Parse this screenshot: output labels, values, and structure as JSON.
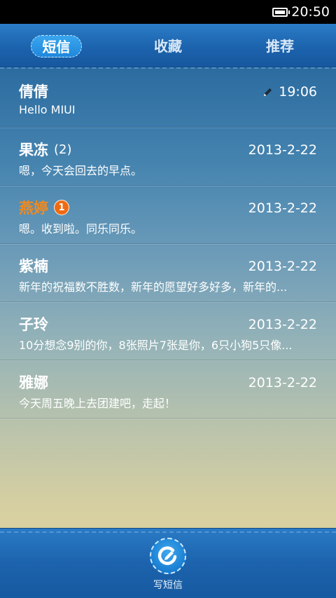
{
  "status_bar": {
    "time": "20:50"
  },
  "tabs": [
    {
      "label": "短信",
      "active": true
    },
    {
      "label": "收藏",
      "active": false
    },
    {
      "label": "推荐",
      "active": false
    }
  ],
  "conversations": [
    {
      "name": "倩倩",
      "count": "",
      "badge": "",
      "date": "19:06",
      "preview": "Hello MIUI",
      "draft": true
    },
    {
      "name": "果冻",
      "count": "(2)",
      "badge": "",
      "date": "2013-2-22",
      "preview": "嗯，今天会回去的早点。"
    },
    {
      "name": "燕婷",
      "count": "",
      "badge": "1",
      "date": "2013-2-22",
      "preview": "嗯。收到啦。同乐同乐。",
      "highlight": true
    },
    {
      "name": "紫楠",
      "count": "",
      "badge": "",
      "date": "2013-2-22",
      "preview": "新年的祝福数不胜数，新年的愿望好多好多，新年的..."
    },
    {
      "name": "子玲",
      "count": "",
      "badge": "",
      "date": "2013-2-22",
      "preview": "10分想念9别的你，8张照片7张是你，6只小狗5只像..."
    },
    {
      "name": "雅娜",
      "count": "",
      "badge": "",
      "date": "2013-2-22",
      "preview": "今天周五晚上去团建吧，走起！"
    }
  ],
  "bottom": {
    "compose_label": "写短信"
  },
  "colors": {
    "accent": "#1c63ad",
    "highlight_name": "#f28a1e",
    "badge": "#f06a12"
  }
}
